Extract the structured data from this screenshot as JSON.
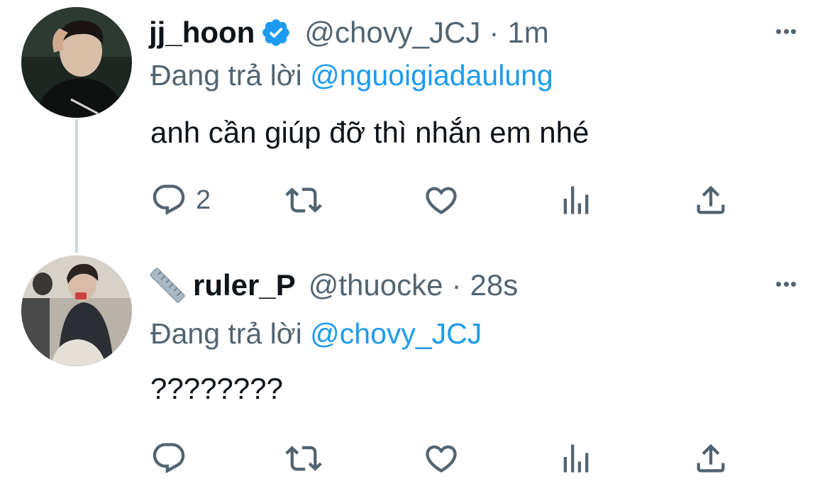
{
  "tweets": [
    {
      "display_name": "jj_hoon",
      "verified": true,
      "handle": "@chovy_JCJ",
      "separator": "·",
      "time": "1m",
      "reply_prefix": "Đang trả lời",
      "reply_to": "@nguoigiadaulung",
      "text": "anh cần giúp đỡ thì nhắn em nhé",
      "reply_count": "2",
      "icons": [
        "more-icon",
        "reply-icon",
        "retweet-icon",
        "like-icon",
        "analytics-icon",
        "share-icon"
      ]
    },
    {
      "display_name": "ruler_P",
      "name_emoji": "straight-ruler-icon",
      "handle": "@thuocke",
      "separator": "·",
      "time": "28s",
      "reply_prefix": "Đang trả lời",
      "reply_to": "@chovy_JCJ",
      "text": "????????",
      "reply_count": "",
      "icons": [
        "more-icon",
        "reply-icon",
        "retweet-icon",
        "like-icon",
        "analytics-icon",
        "share-icon"
      ]
    }
  ],
  "colors": {
    "primary_text": "#0f1419",
    "secondary_text": "#536471",
    "accent": "#1d9bf0",
    "thread_line": "#cfd9de"
  }
}
